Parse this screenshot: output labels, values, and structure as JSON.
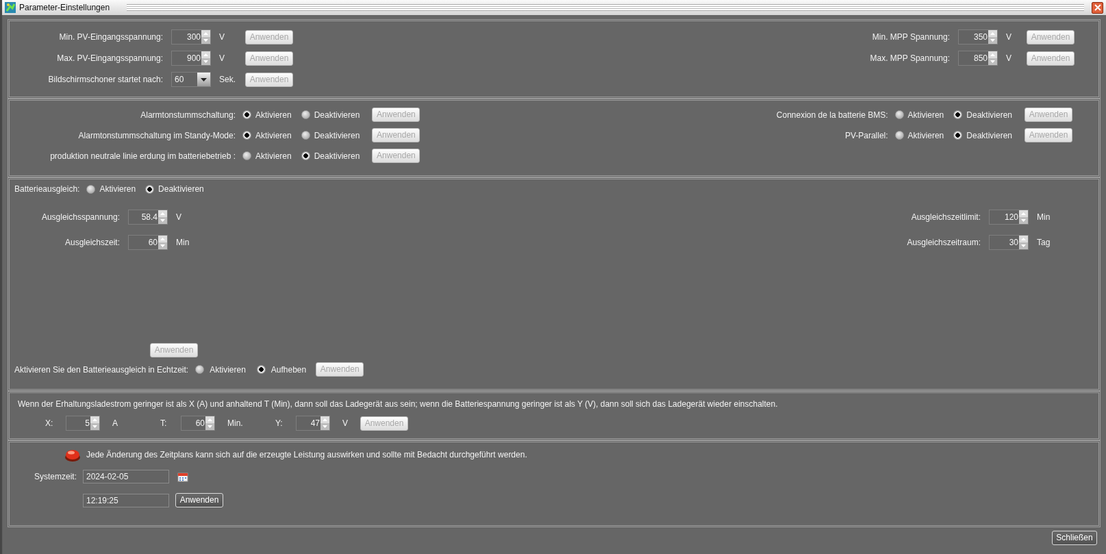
{
  "window": {
    "title": "Parameter-Einstellungen"
  },
  "pv_settings": {
    "left": [
      {
        "kind": "spinner",
        "label": "Min. PV-Eingangsspannung:",
        "value": "300",
        "unit": "V",
        "button": {
          "label": "Anwenden",
          "disabled": true
        }
      },
      {
        "kind": "spinner",
        "label": "Max. PV-Eingangsspannung:",
        "value": "900",
        "unit": "V",
        "button": {
          "label": "Anwenden",
          "disabled": true
        }
      },
      {
        "kind": "dropdown",
        "label": "Bildschirmschoner startet nach:",
        "value": "60",
        "unit": "Sek.",
        "button": {
          "label": "Anwenden",
          "disabled": true
        }
      }
    ],
    "right": [
      {
        "kind": "spinner",
        "label": "Min. MPP Spannung:",
        "value": "350",
        "unit": "V",
        "button": {
          "label": "Anwenden",
          "disabled": true
        }
      },
      {
        "kind": "spinner",
        "label": "Max. MPP Spannung:",
        "value": "850",
        "unit": "V",
        "button": {
          "label": "Anwenden",
          "disabled": true
        }
      }
    ]
  },
  "switch_settings": {
    "left": [
      {
        "label": "Alarmtonstummschaltung:",
        "options": [
          {
            "label": "Aktivieren",
            "selected": true
          },
          {
            "label": "Deaktivieren",
            "selected": false
          }
        ],
        "button": {
          "label": "Anwenden",
          "disabled": true
        }
      },
      {
        "label": "Alarmtonstummschaltung im Standy-Mode:",
        "options": [
          {
            "label": "Aktivieren",
            "selected": true
          },
          {
            "label": "Deaktivieren",
            "selected": false
          }
        ],
        "button": {
          "label": "Anwenden",
          "disabled": true
        }
      },
      {
        "label": "produktion neutrale linie erdung im batteriebetrieb :",
        "options": [
          {
            "label": "Aktivieren",
            "selected": false
          },
          {
            "label": "Deaktivieren",
            "selected": true
          }
        ],
        "button": {
          "label": "Anwenden",
          "disabled": true
        }
      }
    ],
    "right": [
      {
        "label": "Connexion de la batterie BMS:",
        "options": [
          {
            "label": "Aktivieren",
            "selected": false
          },
          {
            "label": "Deaktivieren",
            "selected": true
          }
        ],
        "button": {
          "label": "Anwenden",
          "disabled": true
        }
      },
      {
        "label": "PV-Parallel:",
        "options": [
          {
            "label": "Aktivieren",
            "selected": false
          },
          {
            "label": "Deaktivieren",
            "selected": true
          }
        ],
        "button": {
          "label": "Anwenden",
          "disabled": true
        }
      }
    ]
  },
  "equalization": {
    "label": "Batterieausgleich:",
    "options": [
      {
        "label": "Aktivieren",
        "selected": false
      },
      {
        "label": "Deaktivieren",
        "selected": true
      }
    ],
    "left": [
      {
        "label": "Ausgleichsspannung:",
        "value": "58.4",
        "unit": "V"
      },
      {
        "label": "Ausgleichszeit:",
        "value": "60",
        "unit": "Min"
      }
    ],
    "right": [
      {
        "label": "Ausgleichszeitlimit:",
        "value": "120",
        "unit": "Min"
      },
      {
        "label": "Ausgleichszeitraum:",
        "value": "30",
        "unit": "Tag"
      }
    ],
    "button": {
      "label": "Anwenden",
      "disabled": true
    },
    "realtime": {
      "label": "Aktivieren Sie den Batterieausgleich in Echtzeit:",
      "options": [
        {
          "label": "Aktivieren",
          "selected": false
        },
        {
          "label": "Aufheben",
          "selected": true
        }
      ],
      "button": {
        "label": "Anwenden",
        "disabled": true
      }
    }
  },
  "float_charge": {
    "description": "Wenn der Erhaltungsladestrom geringer ist als X (A) und anhaltend T (Min), dann soll das Ladegerät aus sein; wenn die Batteriespannung geringer ist als Y (V), dann soll sich das Ladegerät wieder einschalten.",
    "fields": [
      {
        "label": "X:",
        "value": "5",
        "unit": "A"
      },
      {
        "label": "T:",
        "value": "60",
        "unit": "Min."
      },
      {
        "label": "Y:",
        "value": "47",
        "unit": "V"
      }
    ],
    "button": {
      "label": "Anwenden",
      "disabled": true
    }
  },
  "system_time": {
    "warning": "Jede Änderung des Zeitplans kann sich auf die erzeugte Leistung auswirken und sollte mit Bedacht durchgeführt werden.",
    "label": "Systemzeit:",
    "date": "2024-02-05",
    "time": "12:19:25",
    "button": {
      "label": "Anwenden",
      "disabled": false
    }
  },
  "close_button": {
    "label": "Schließen",
    "disabled": false
  }
}
